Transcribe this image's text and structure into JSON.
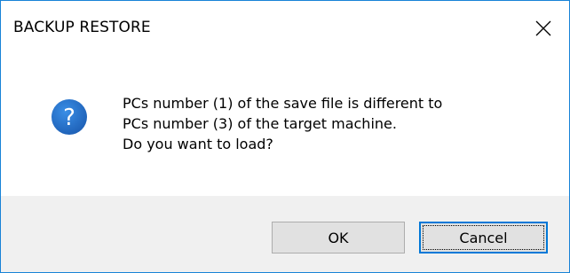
{
  "window": {
    "title": "BACKUP RESTORE",
    "accent_color": "#1883d7"
  },
  "titlebar": {
    "close_icon": "close-icon"
  },
  "message": {
    "icon": "question-icon",
    "icon_color": "#1e6bc2",
    "lines": [
      "PCs number (1) of the save file is different to",
      "PCs number (3) of the target machine.",
      "Do you want to load?"
    ]
  },
  "buttons": {
    "ok_label": "OK",
    "cancel_label": "Cancel",
    "default_button": "Cancel"
  }
}
